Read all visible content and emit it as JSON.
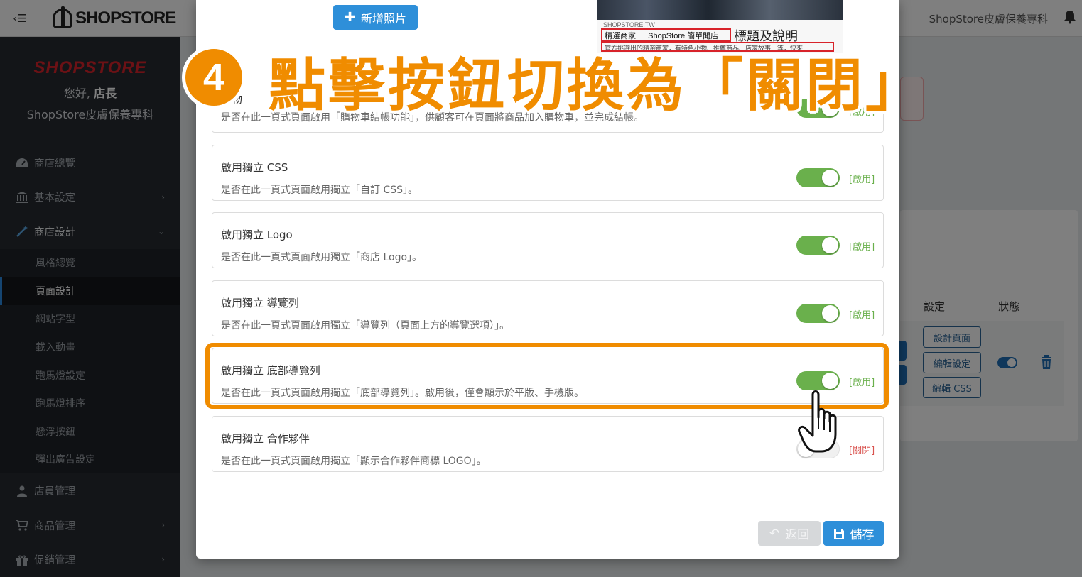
{
  "topbar": {
    "menu_icon": "hamburger-collapse-icon",
    "brand": "SHOPSTORE",
    "store_name": "ShopStore皮膚保養專科",
    "bell_icon": "bell-icon"
  },
  "sidebar": {
    "brand_logo": "SHOPSTORE",
    "greeting_prefix": "您好, ",
    "greeting_name": "店長",
    "store_name": "ShopStore皮膚保養專科",
    "items": [
      {
        "label": "商店總覽",
        "icon": "dashboard-icon"
      },
      {
        "label": "基本設定",
        "icon": "bank-icon"
      },
      {
        "label": "商店設計",
        "icon": "magic-wand-icon"
      }
    ],
    "subitems": [
      {
        "label": "風格總覽"
      },
      {
        "label": "頁面設計"
      },
      {
        "label": "網站字型"
      },
      {
        "label": "載入動畫"
      },
      {
        "label": "跑馬燈設定"
      },
      {
        "label": "跑馬燈排序"
      },
      {
        "label": "懸浮按鈕"
      },
      {
        "label": "彈出廣告設定"
      }
    ],
    "items_after": [
      {
        "label": "店員管理",
        "icon": "users-icon"
      },
      {
        "label": "商品管理",
        "icon": "cart-icon"
      },
      {
        "label": "促銷管理",
        "icon": "gift-icon"
      }
    ]
  },
  "background": {
    "col_settings": "設定",
    "col_status": "狀態",
    "buttons": [
      "設計頁面",
      "編輯設定",
      "編輯 CSS"
    ]
  },
  "modal": {
    "add_photo_label": "新增照片",
    "preview": {
      "domain": "SHOPSTORE.TW",
      "tagline": "精選商家 ｜ ShopStore 簡單開店",
      "caption": "標題及說明",
      "desc": "官方挑選出的精選商家，有特色小物、推薦商品、店家故事…等，快來"
    },
    "settings": [
      {
        "title": "購物",
        "desc": "是否在此一頁式頁面啟用「購物車結帳功能」，供顧客可在頁面將商品加入購物車，並完成結帳。",
        "state": "[啟用]",
        "on": true
      },
      {
        "title": "啟用獨立 CSS",
        "desc": "是否在此一頁式頁面啟用獨立「自訂 CSS」。",
        "state": "[啟用]",
        "on": true
      },
      {
        "title": "啟用獨立 Logo",
        "desc": "是否在此一頁式頁面啟用獨立「商店 Logo」。",
        "state": "[啟用]",
        "on": true
      },
      {
        "title": "啟用獨立 導覽列",
        "desc": "是否在此一頁式頁面啟用獨立「導覽列（頁面上方的導覽選項）」。",
        "state": "[啟用]",
        "on": true
      },
      {
        "title": "啟用獨立 底部導覽列",
        "desc": "是否在此一頁式頁面啟用獨立「底部導覽列」。啟用後，僅會顯示於平版、手機版。",
        "state": "[啟用]",
        "on": true
      },
      {
        "title": "啟用獨立 合作夥伴",
        "desc": "是否在此一頁式頁面啟用獨立「顯示合作夥伴商標 LOGO」。",
        "state": "[關閉]",
        "on": false
      }
    ],
    "back_label": "返回",
    "save_label": "儲存"
  },
  "annotation": {
    "step_number": "4",
    "instruction": "點擊按鈕切換為「關閉」",
    "accent_color": "#f08c00"
  },
  "colors": {
    "toggle_on": "#6ab04c",
    "primary": "#2e8fd9",
    "sidebar_bg": "#262b31"
  }
}
